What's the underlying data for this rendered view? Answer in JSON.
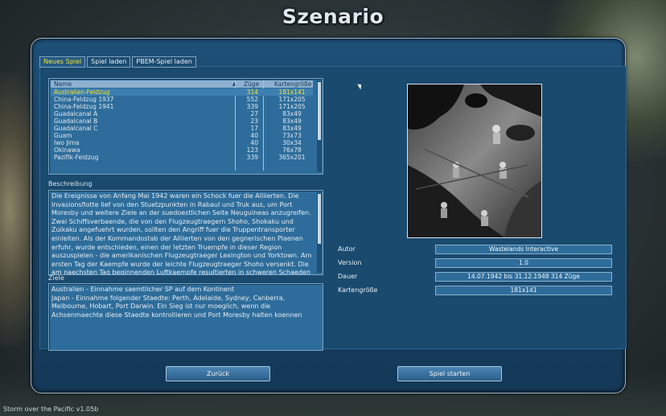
{
  "window": {
    "title": "Szenario",
    "version": "Storm over the Pacific v1.05b"
  },
  "tabs": [
    {
      "label": "Neues Spiel",
      "active": true
    },
    {
      "label": "Spiel laden",
      "active": false
    },
    {
      "label": "PBEM-Spiel laden",
      "active": false
    }
  ],
  "scenario_list": {
    "headers": {
      "name": "Name",
      "moves": "Züge",
      "size": "Kartengröße"
    },
    "rows": [
      {
        "name": "Australien-Feldzug",
        "moves": "314",
        "size": "181x141",
        "selected": true
      },
      {
        "name": "China-Feldzug 1937",
        "moves": "552",
        "size": "171x205"
      },
      {
        "name": "China-Feldzug 1941",
        "moves": "339",
        "size": "171x205"
      },
      {
        "name": "Guadalcanal A",
        "moves": "27",
        "size": "83x49"
      },
      {
        "name": "Guadalcanal B",
        "moves": "23",
        "size": "83x49"
      },
      {
        "name": "Guadalcanal C",
        "moves": "17",
        "size": "83x49"
      },
      {
        "name": "Guam",
        "moves": "40",
        "size": "73x73"
      },
      {
        "name": "Iwo Jima",
        "moves": "40",
        "size": "30x34"
      },
      {
        "name": "Okinawa",
        "moves": "123",
        "size": "76x78"
      },
      {
        "name": "Pazifik-Feldzug",
        "moves": "339",
        "size": "365x201"
      }
    ]
  },
  "description": {
    "label": "Beschreibung",
    "text": "Die Ereignisse von Anfang Mai 1942 waren ein Schock fuer die Alliierten. Die Invasionsflotte lief von den Stuetzpunkten in Rabaul und Truk aus, um Port Moresby und weitere Ziele an der suedoestlichen Seite Neuguineas anzugreifen. Zwei Schiffsverbaende, die von den Flugzeugtraegern Shoho, Shokaku und Zuikaku angefuehrt wurden, sollten den Angriff fuer die Truppentransporter einleiten. Als der Kommandostab der Alliierten von den gegnerischen Plaenen erfuhr, wurde entschieden, einen der letzten Truempfe in dieser Region auszuspielen - die amerikanischen Flugzeugtraeger Lexington und Yorktown. Am ersten Tag der Kaempfe wurde der leichte Flugzeugtraeger Shoho versenkt. Die am naechsten Tag beginnenden Luftkaempfe resultierten in schweren Schaeden an Deck der Shokaku,"
  },
  "goals": {
    "label": "Ziele",
    "text": "Australien - Einnahme saemtlicher SP auf dem Kontinent\nJapan - Einnahme folgender Staedte: Perth, Adelaide, Sydney, Canberra, Melbourne, Hobart, Port Darwin. Ein Sieg ist nur moeglich, wenn die Achsenmaechte diese Staedte kontrollieren und Port Moresby halten koennen"
  },
  "info": {
    "author_label": "Autor",
    "author": "Wastelands Interactive",
    "version_label": "Version",
    "version": "1.0",
    "duration_label": "Dauer",
    "duration": "14.07.1942 bis 31.12.1948   314 Züge",
    "mapsize_label": "Kartengröße",
    "mapsize": "181x141"
  },
  "buttons": {
    "back": "Zurück",
    "start": "Spiel starten"
  },
  "colors": {
    "accent_yellow": "#f0e23a",
    "panel_blue": "#1e5078",
    "field_blue": "#2e6d9b"
  }
}
